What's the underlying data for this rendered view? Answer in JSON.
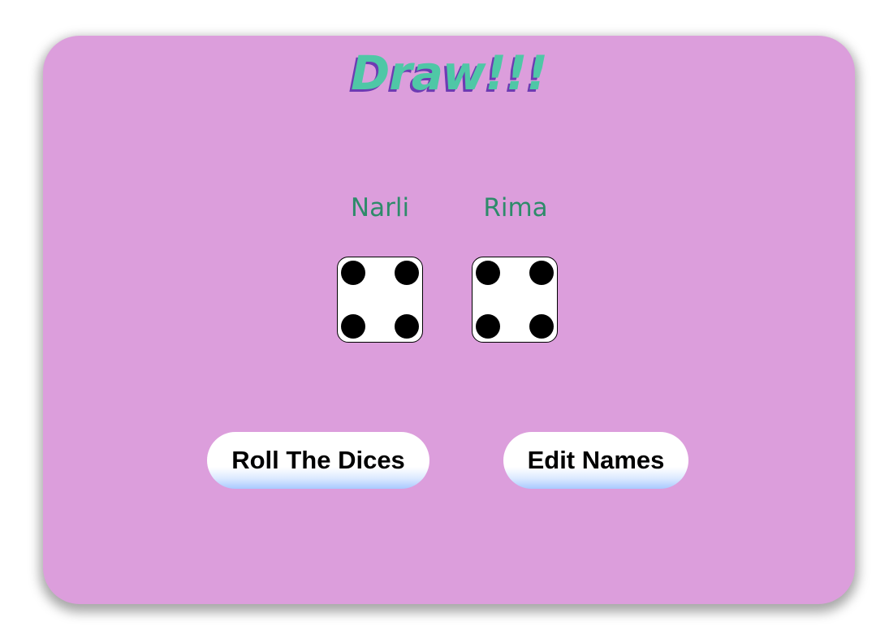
{
  "game": {
    "title": "Draw!!!",
    "players": [
      {
        "name": "Narli",
        "die_value": 4
      },
      {
        "name": "Rima",
        "die_value": 4
      }
    ],
    "buttons": {
      "roll_label": "Roll The Dices",
      "edit_label": "Edit Names"
    },
    "colors": {
      "background": "#dc9edc",
      "title": "#4fc7a6",
      "title_shadow": "#6d3bb3",
      "player_name": "#2e8b6a"
    }
  }
}
